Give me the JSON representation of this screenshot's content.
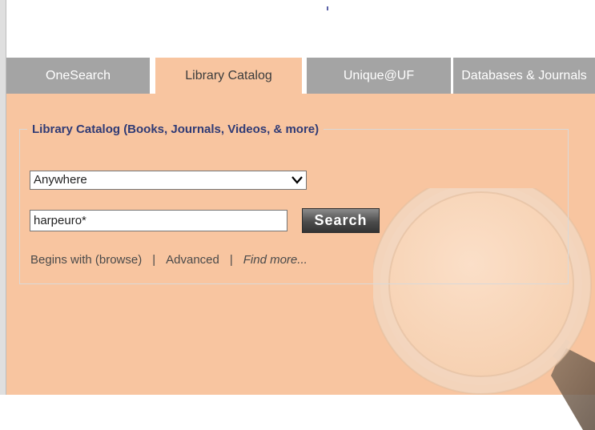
{
  "tabs": [
    {
      "label": "OneSearch",
      "active": false
    },
    {
      "label": "Library Catalog",
      "active": true
    },
    {
      "label": "Unique@UF",
      "active": false
    },
    {
      "label": "Databases & Journals",
      "active": false
    }
  ],
  "catalog": {
    "legend": "Library Catalog (Books, Journals, Videos, & more)",
    "scope_select_value": "Anywhere",
    "search_input_value": "harpeuro*",
    "search_button_label": "Search",
    "links": {
      "browse": "Begins with (browse)",
      "separator_1": "|",
      "advanced": "Advanced",
      "separator_2": "|",
      "find_more": "Find more..."
    }
  },
  "icons": {
    "select_chevron": "chevron-down-icon",
    "decorative_background": "magnifying-glass-icon"
  },
  "colors": {
    "panel_bg": "#f8c5a0",
    "tab_inactive_bg": "#a4a4a4",
    "tab_inactive_text": "#ffffff",
    "legend_text": "#303b75",
    "button_bg": "#4c4c4c"
  }
}
